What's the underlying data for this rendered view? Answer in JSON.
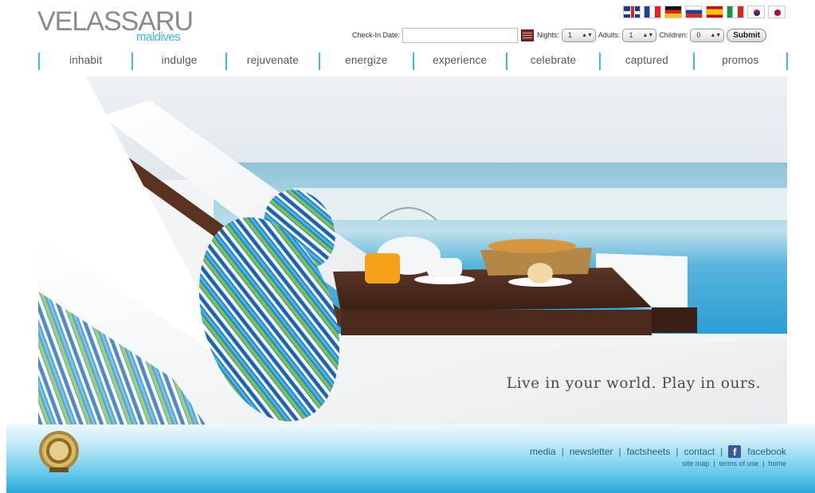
{
  "logo": {
    "brand": "VELASSARU",
    "location": "maldives"
  },
  "languages": [
    "English",
    "French",
    "German",
    "Russian",
    "Spanish",
    "Italian",
    "Korean",
    "Japanese"
  ],
  "booking": {
    "checkin_label": "Check-In Date:",
    "checkin_value": "",
    "calendar_icon": "calendar-icon",
    "nights_label": "Nights:",
    "nights_value": "1",
    "adults_label": "Adults:",
    "adults_value": "1",
    "children_label": "Children:",
    "children_value": "0",
    "submit_label": "Submit"
  },
  "nav": {
    "items": [
      "inhabit",
      "indulge",
      "rejuvenate",
      "energize",
      "experience",
      "celebrate",
      "captured",
      "promos"
    ]
  },
  "hero": {
    "tagline": "Live in your world. Play in ours."
  },
  "footer": {
    "links": [
      "media",
      "newsletter",
      "factsheets",
      "contact",
      "facebook"
    ],
    "sub_links": [
      "site map",
      "terms of use",
      "home"
    ],
    "colors": {
      "accent": "#44b8e3",
      "link": "#1d5f93",
      "facebook": "#3b5998"
    }
  }
}
